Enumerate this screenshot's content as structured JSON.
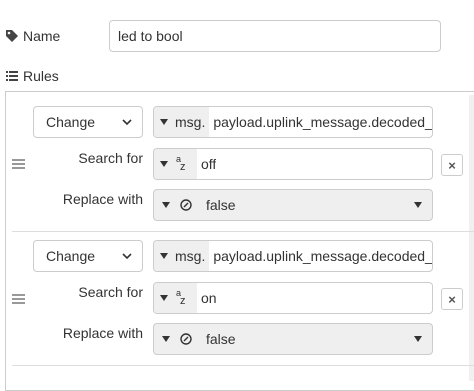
{
  "name": {
    "label": "Name",
    "value": "led to bool"
  },
  "rules": {
    "label": "Rules",
    "items": [
      {
        "action": "Change",
        "property_type": "msg.",
        "property": "payload.uplink_message.decoded_p",
        "search_label": "Search for",
        "search_value": "off",
        "replace_label": "Replace with",
        "replace_value": "false"
      },
      {
        "action": "Change",
        "property_type": "msg.",
        "property": "payload.uplink_message.decoded_p",
        "search_label": "Search for",
        "search_value": "on",
        "replace_label": "Replace with",
        "replace_value": "false"
      }
    ]
  },
  "icons": {
    "remove": "×"
  }
}
